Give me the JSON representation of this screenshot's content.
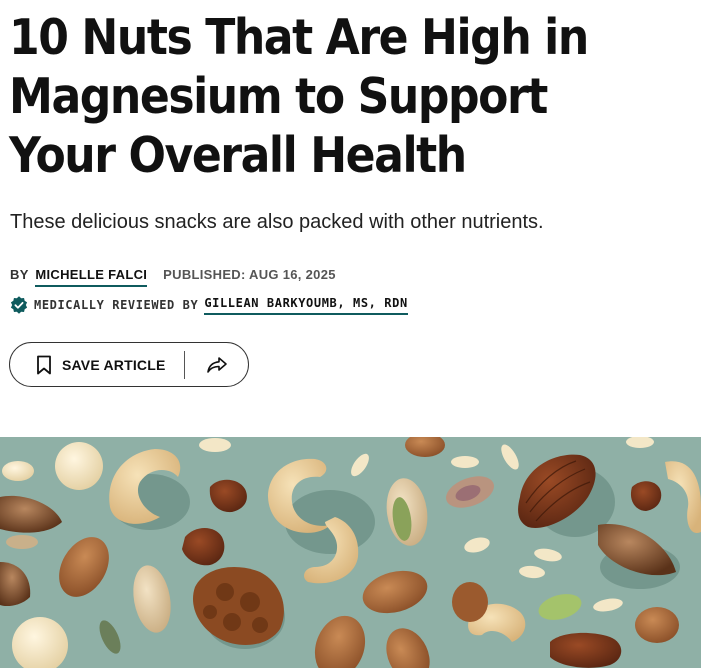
{
  "article": {
    "title": "10 Nuts That Are High in Magnesium to Support Your Overall Health",
    "subtitle": "These delicious snacks are also packed with other nutrients.",
    "byline": {
      "prefix": "BY",
      "author": "MICHELLE FALCI",
      "published": "PUBLISHED: AUG 16, 2025"
    },
    "review": {
      "prefix": "MEDICALLY REVIEWED BY",
      "reviewer": "GILLEAN BARKYOUMB, MS, RDN"
    }
  },
  "actions": {
    "save_label": "SAVE ARTICLE"
  },
  "colors": {
    "accent": "#0f5b5e",
    "hero_background": "#8fb0a6"
  },
  "icons": {
    "badge": "verified-check-icon",
    "save": "bookmark-icon",
    "share": "share-arrow-icon"
  }
}
